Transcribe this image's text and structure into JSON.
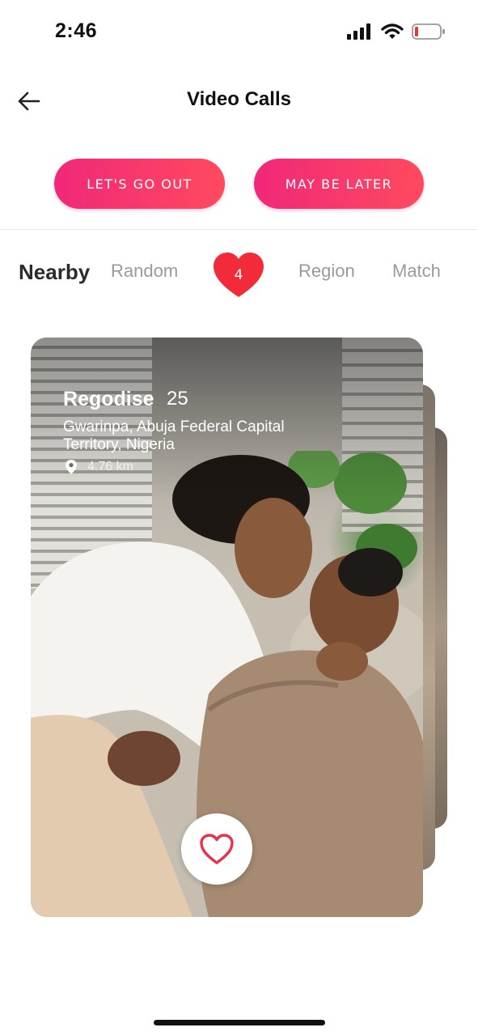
{
  "status": {
    "time": "2:46",
    "icons": [
      "signal-icon",
      "wifi-icon",
      "battery-icon"
    ],
    "battery_color": "#e53935"
  },
  "header": {
    "title": "Video Calls",
    "back_icon": "arrow-left-icon"
  },
  "actions": {
    "go_out_label": "LET'S GO OUT",
    "later_label": "MAY BE LATER"
  },
  "tabs": {
    "items": [
      {
        "label": "Nearby",
        "active": true
      },
      {
        "label": "Random",
        "active": false
      },
      {
        "label": "Region",
        "active": false
      },
      {
        "label": "Match",
        "active": false
      }
    ],
    "badge_count": "4"
  },
  "card": {
    "name": "Regodise",
    "age": "25",
    "location": "Gwarinpa, Abuja Federal Capital Territory, Nigeria",
    "distance": "4.76 km",
    "like_icon": "heart-icon"
  },
  "colors": {
    "accent_start": "#f0287a",
    "accent_end": "#ff4a5e",
    "badge": "#f22b3a",
    "heart": "#e8304f"
  }
}
